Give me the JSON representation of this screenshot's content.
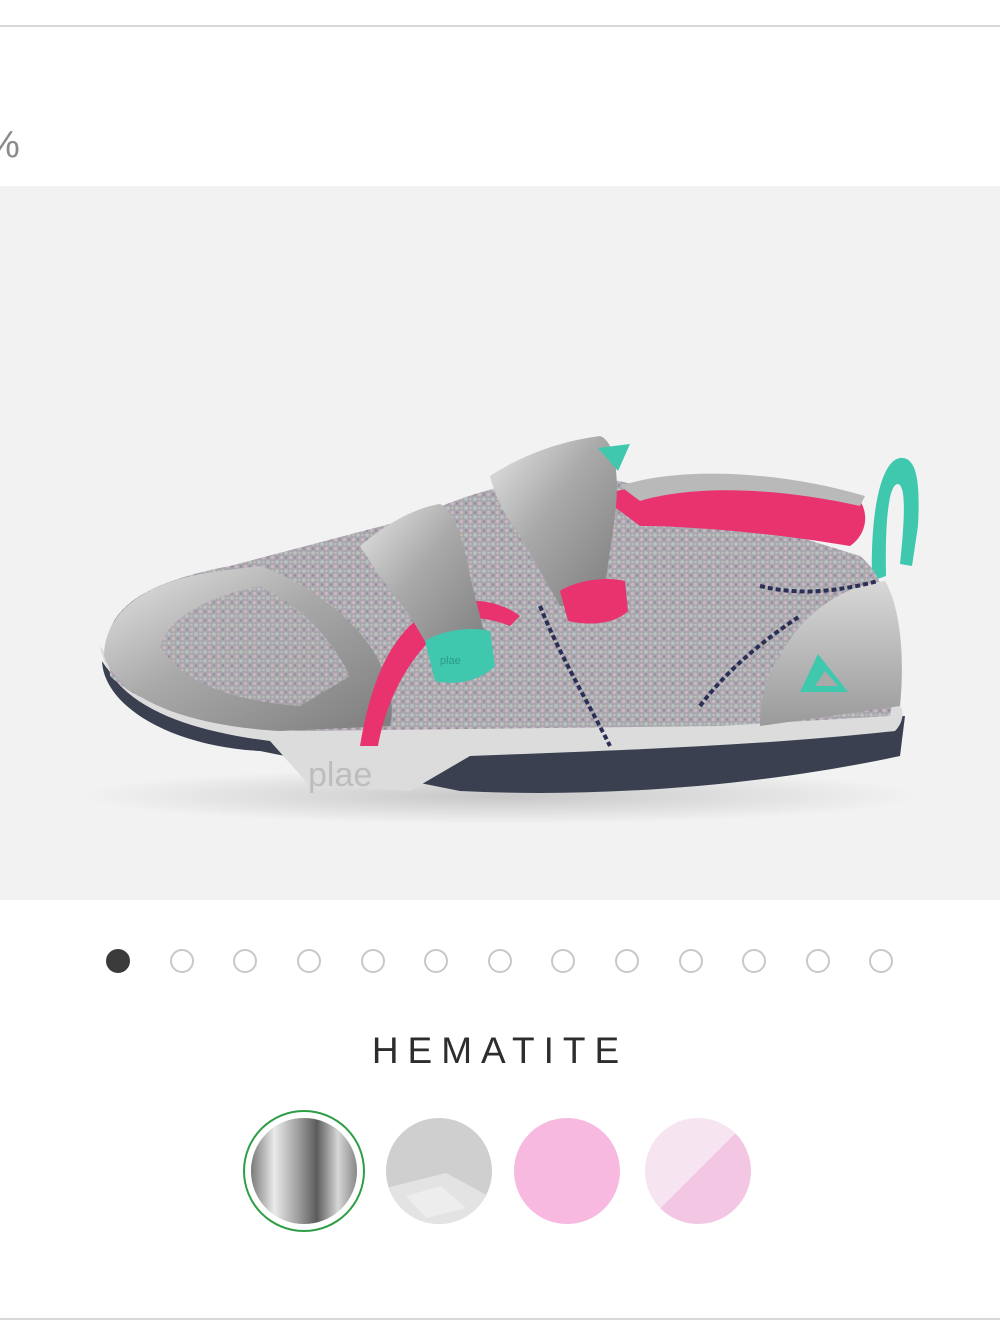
{
  "header": {
    "cut_text": "%"
  },
  "product_image": {
    "alt_icon": "sneaker-image",
    "brand_on_sole": "plae",
    "tab_text": "plae"
  },
  "carousel": {
    "total_dots": 13,
    "active_index": 0
  },
  "color": {
    "name": "HEMATITE"
  },
  "swatches": [
    {
      "name": "hematite",
      "selected": true,
      "color": "#9c9c9c"
    },
    {
      "name": "grey",
      "selected": false,
      "color": "#cfcfcf"
    },
    {
      "name": "pink",
      "selected": false,
      "color": "#f7b9df"
    },
    {
      "name": "light-pink",
      "selected": false,
      "color": "#f6e4f1"
    }
  ],
  "colors": {
    "selection_ring": "#2e9e45",
    "active_dot": "#3b3b3b",
    "inactive_dot_border": "#c8c8c8"
  }
}
